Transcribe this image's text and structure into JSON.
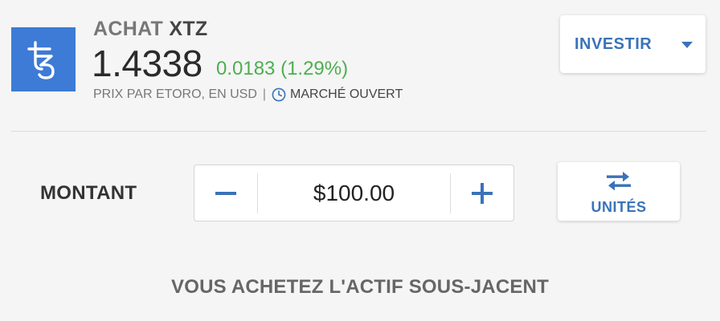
{
  "header": {
    "action": "ACHAT",
    "symbol": "XTZ",
    "price": "1.4338",
    "change": "0.0183 (1.29%)",
    "price_source": "PRIX PAR ETORO, EN USD",
    "separator": "|",
    "market_status": "MARCHÉ OUVERT",
    "logo_icon": "tezos-icon",
    "logo_color": "#3d7bd6",
    "change_color": "#4caf50"
  },
  "invest": {
    "label": "INVESTIR",
    "icon": "chevron-down-icon",
    "color": "#3a73b8"
  },
  "amount": {
    "label": "MONTANT",
    "value": "$100.00",
    "minus_icon": "minus-icon",
    "plus_icon": "plus-icon"
  },
  "units": {
    "label": "UNITÉS",
    "icon": "swap-icon"
  },
  "footer": {
    "text": "VOUS ACHETEZ L'ACTIF SOUS-JACENT"
  }
}
